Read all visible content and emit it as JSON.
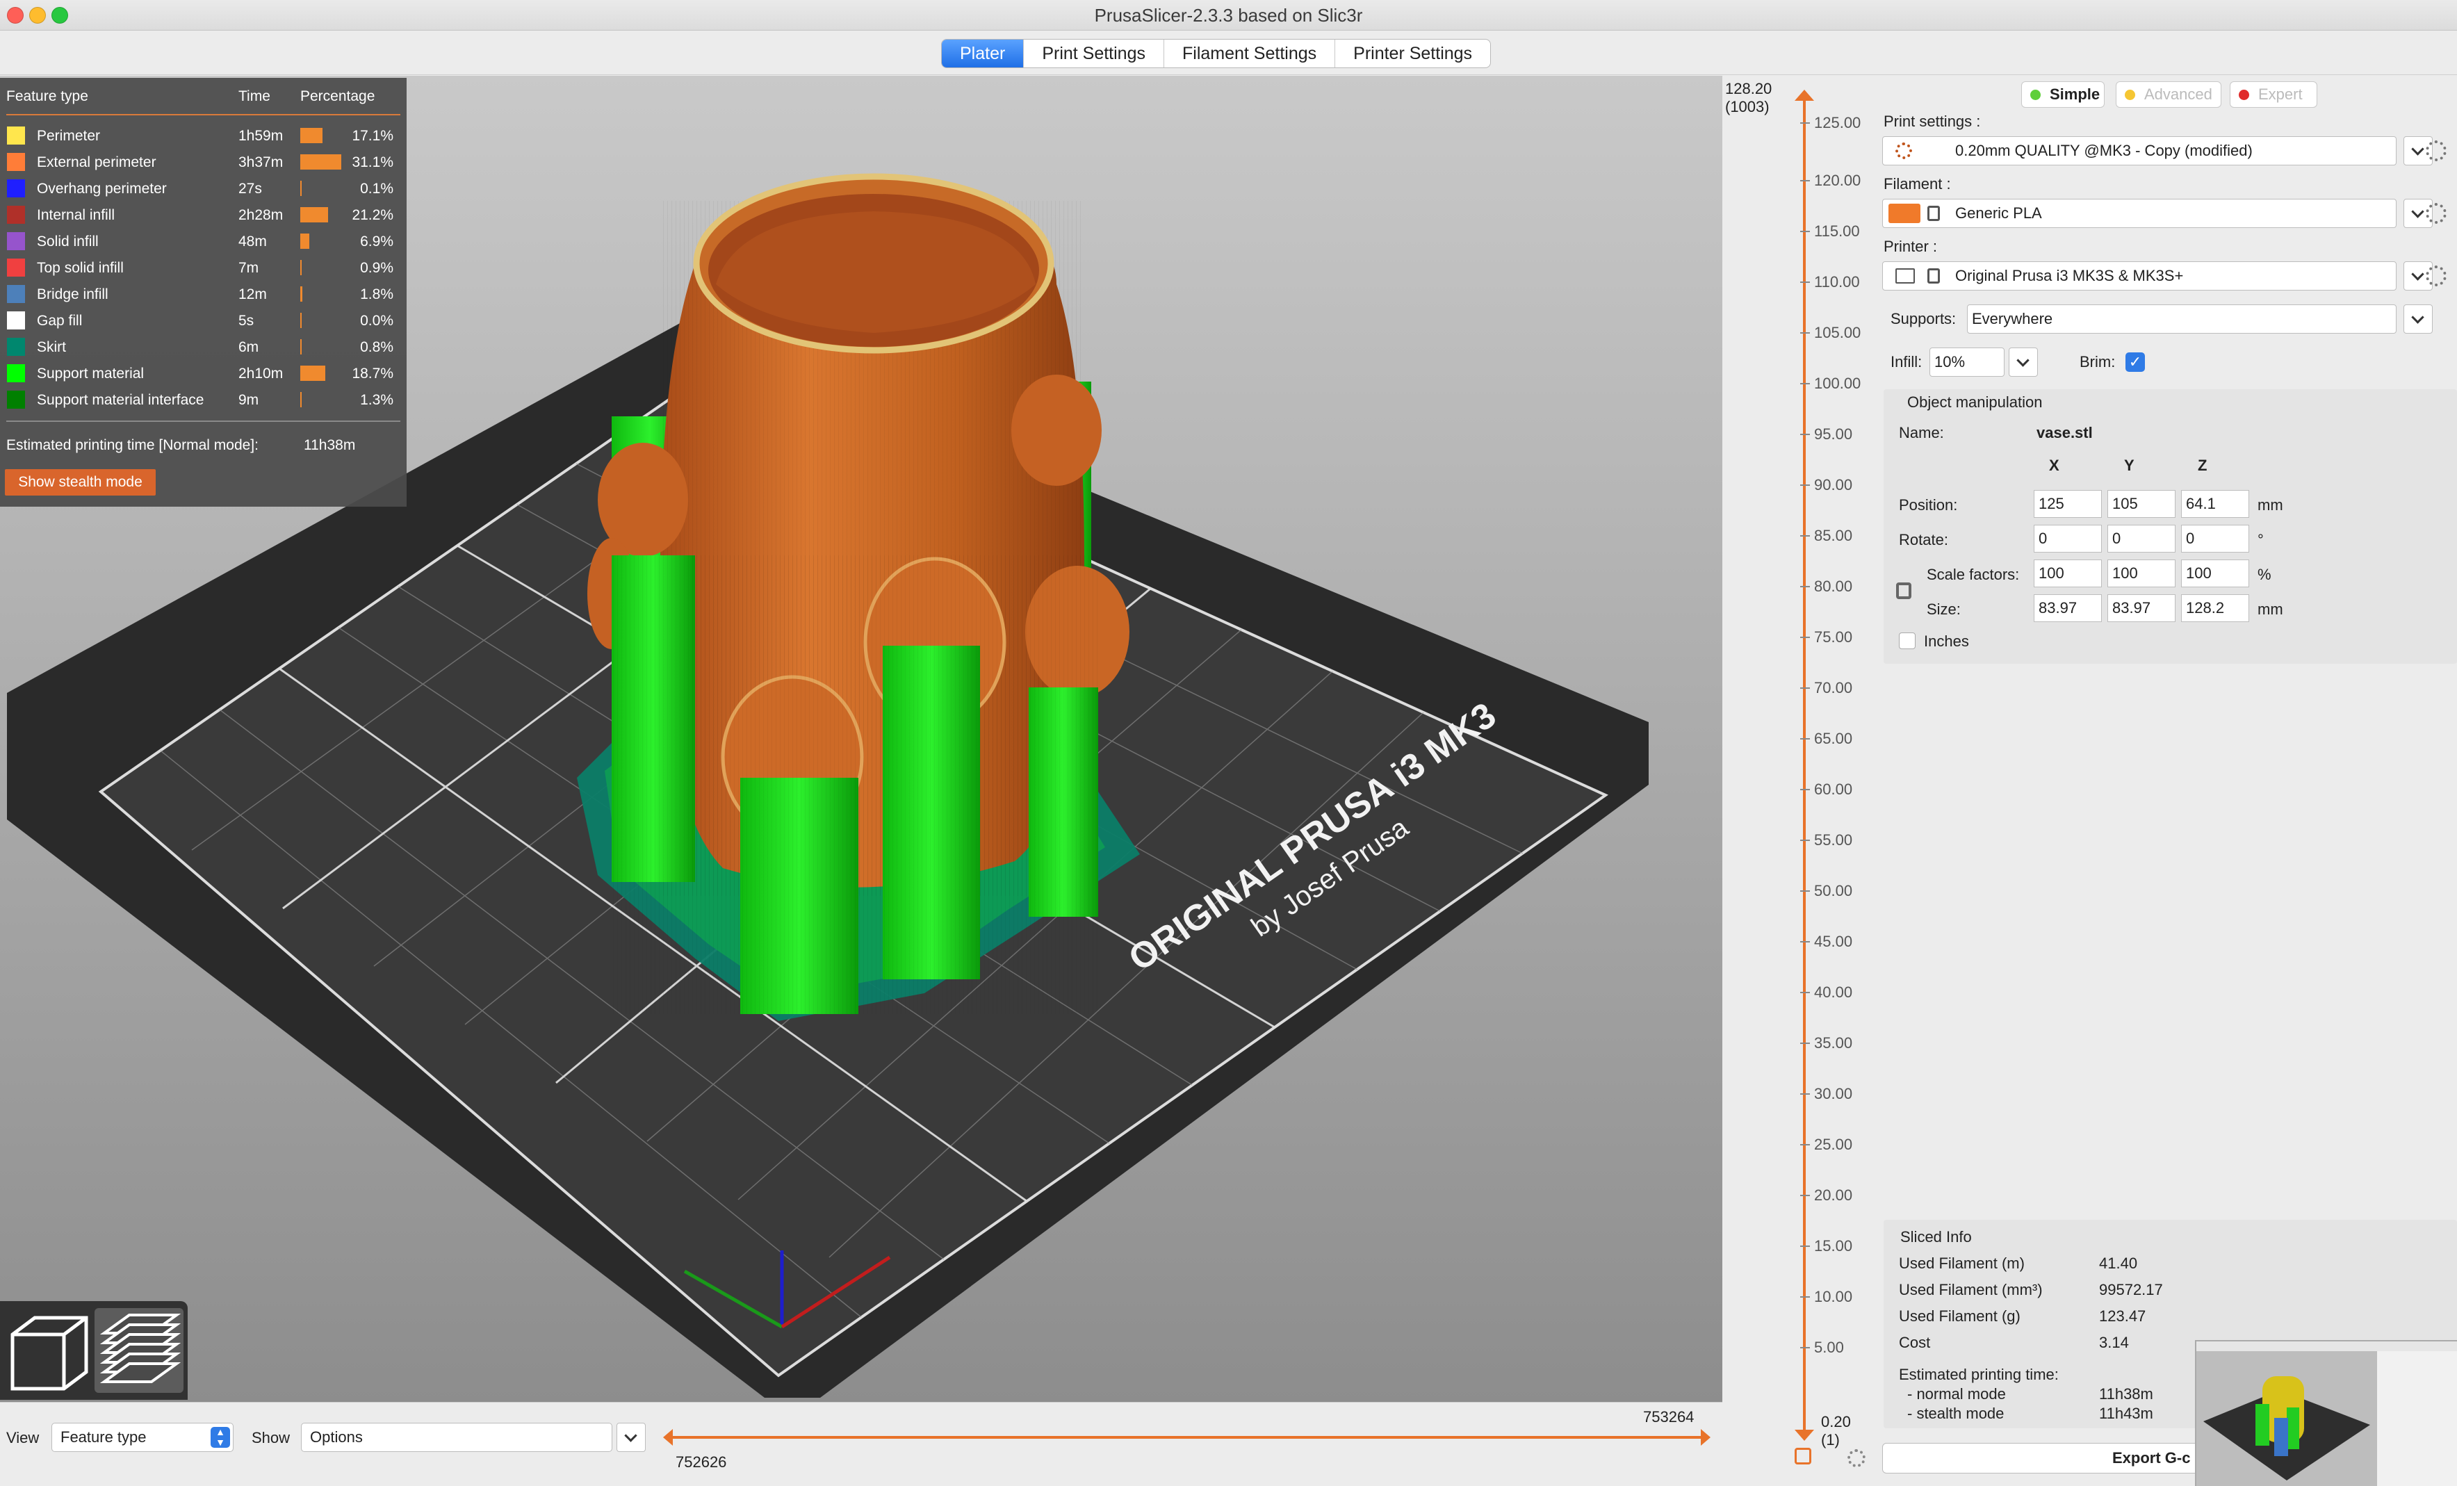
{
  "window": {
    "title": "PrusaSlicer-2.3.3 based on Slic3r"
  },
  "tabs": [
    {
      "label": "Plater"
    },
    {
      "label": "Print Settings"
    },
    {
      "label": "Filament Settings"
    },
    {
      "label": "Printer Settings"
    }
  ],
  "legend": {
    "headers": {
      "feature": "Feature type",
      "time": "Time",
      "percentage": "Percentage"
    },
    "rows": [
      {
        "name": "Perimeter",
        "time": "1h59m",
        "pct": "17.1%",
        "fraction": 0.171,
        "color": "#ffe64d"
      },
      {
        "name": "External perimeter",
        "time": "3h37m",
        "pct": "31.1%",
        "fraction": 0.311,
        "color": "#ff7d38"
      },
      {
        "name": "Overhang perimeter",
        "time": "27s",
        "pct": "0.1%",
        "fraction": 0.001,
        "color": "#1f1fff"
      },
      {
        "name": "Internal infill",
        "time": "2h28m",
        "pct": "21.2%",
        "fraction": 0.212,
        "color": "#b03029"
      },
      {
        "name": "Solid infill",
        "time": "48m",
        "pct": "6.9%",
        "fraction": 0.069,
        "color": "#9654cc"
      },
      {
        "name": "Top solid infill",
        "time": "7m",
        "pct": "0.9%",
        "fraction": 0.009,
        "color": "#f04040"
      },
      {
        "name": "Bridge infill",
        "time": "12m",
        "pct": "1.8%",
        "fraction": 0.018,
        "color": "#4d80ba"
      },
      {
        "name": "Gap fill",
        "time": "5s",
        "pct": "0.0%",
        "fraction": 0.0,
        "color": "#ffffff"
      },
      {
        "name": "Skirt",
        "time": "6m",
        "pct": "0.8%",
        "fraction": 0.008,
        "color": "#00876e"
      },
      {
        "name": "Support material",
        "time": "2h10m",
        "pct": "18.7%",
        "fraction": 0.187,
        "color": "#00ff00"
      },
      {
        "name": "Support material interface",
        "time": "9m",
        "pct": "1.3%",
        "fraction": 0.013,
        "color": "#008000"
      }
    ],
    "estimate_label": "Estimated printing time [Normal mode]:",
    "estimate_value": "11h38m",
    "stealth_button": "Show stealth mode"
  },
  "bed": {
    "brand_line1": "ORIGINAL PRUSA i3 MK3",
    "brand_line2": "by Josef Prusa"
  },
  "bottom_bar": {
    "view_label": "View",
    "view_value": "Feature type",
    "show_label": "Show",
    "show_value": "Options",
    "slider_left": "752626",
    "slider_right": "753264"
  },
  "layer_slider": {
    "top_value": "128.20",
    "top_layer": "(1003)",
    "bottom_value": "0.20",
    "bottom_layer": "(1)",
    "ticks": [
      "125.00",
      "120.00",
      "115.00",
      "110.00",
      "105.00",
      "100.00",
      "95.00",
      "90.00",
      "85.00",
      "80.00",
      "75.00",
      "70.00",
      "65.00",
      "60.00",
      "55.00",
      "50.00",
      "45.00",
      "40.00",
      "35.00",
      "30.00",
      "25.00",
      "20.00",
      "15.00",
      "10.00",
      "5.00"
    ]
  },
  "sidebar": {
    "modes": {
      "simple": "Simple",
      "advanced": "Advanced",
      "expert": "Expert"
    },
    "print_settings_label": "Print settings :",
    "print_settings_value": "0.20mm QUALITY @MK3 - Copy (modified)",
    "filament_label": "Filament :",
    "filament_value": "Generic PLA",
    "filament_color": "#f07a2a",
    "printer_label": "Printer :",
    "printer_value": "Original Prusa i3 MK3S & MK3S+",
    "supports_label": "Supports:",
    "supports_value": "Everywhere",
    "infill_label": "Infill:",
    "infill_value": "10%",
    "brim_label": "Brim:",
    "brim_checked": true
  },
  "object_manipulation": {
    "title": "Object manipulation",
    "name_label": "Name:",
    "name_value": "vase.stl",
    "axes": {
      "x": "X",
      "y": "Y",
      "z": "Z"
    },
    "position_label": "Position:",
    "position": {
      "x": "125",
      "y": "105",
      "z": "64.1"
    },
    "position_unit": "mm",
    "rotate_label": "Rotate:",
    "rotate": {
      "x": "0",
      "y": "0",
      "z": "0"
    },
    "rotate_unit": "°",
    "scale_label": "Scale factors:",
    "scale": {
      "x": "100",
      "y": "100",
      "z": "100"
    },
    "scale_unit": "%",
    "size_label": "Size:",
    "size": {
      "x": "83.97",
      "y": "83.97",
      "z": "128.2"
    },
    "size_unit": "mm",
    "inches_label": "Inches"
  },
  "sliced_info": {
    "title": "Sliced Info",
    "rows": [
      {
        "label": "Used Filament (m)",
        "value": "41.40"
      },
      {
        "label": "Used Filament (mm³)",
        "value": "99572.17"
      },
      {
        "label": "Used Filament (g)",
        "value": "123.47"
      },
      {
        "label": "Cost",
        "value": "3.14"
      }
    ],
    "time_label": "Estimated printing time:",
    "normal_label": "- normal mode",
    "normal_value": "11h38m",
    "stealth_label": "- stealth mode",
    "stealth_value": "11h43m",
    "export_button": "Export G-c"
  }
}
